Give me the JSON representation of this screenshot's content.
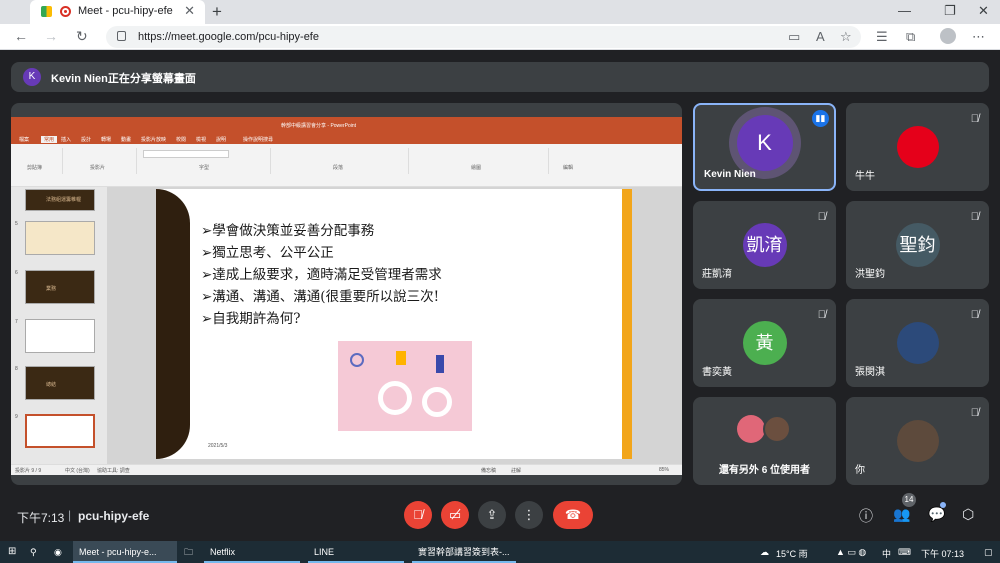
{
  "browser": {
    "tab_title": "Meet - pcu-hipy-efe",
    "tab_close": "✕",
    "new_tab": "+",
    "url": "https://meet.google.com/pcu-hipy-efe",
    "window_controls": [
      "—",
      "❐",
      "✕"
    ],
    "nav_icons": [
      "←",
      "→",
      "↻"
    ],
    "addr_icons": [
      "▭",
      "A",
      "☆",
      "☰",
      "⧉",
      "⋯"
    ]
  },
  "presenting": {
    "avatar_letter": "K",
    "text": "Kevin Nien正在分享螢幕畫面"
  },
  "powerpoint": {
    "title": "幹部中級講習會分享 - PowerPoint",
    "menu": [
      "檔案",
      "常用",
      "插入",
      "設計",
      "轉場",
      "動畫",
      "投影片放映",
      "校閱",
      "檢視",
      "說明",
      "操作說明搜尋"
    ],
    "ribbon_groups": [
      "剪貼簿",
      "投影片",
      "字型",
      "段落",
      "繪圖",
      "編輯"
    ],
    "thumb_numbers": [
      "5",
      "6",
      "7",
      "8",
      "9"
    ],
    "thumb_labels": [
      "法務組運籌帷幄",
      "",
      "業務",
      "",
      "總結",
      ""
    ],
    "slide_lines": [
      "➢學會做決策並妥善分配事務",
      "➢獨立思考、公平公正",
      "➢達成上級要求，適時滿足受管理者需求",
      "➢溝通、溝通、溝通(很重要所以說三次!",
      "➢自我期許為何?"
    ],
    "slide_date": "2021/5/3",
    "status_left": "投影片 9 / 9",
    "status_lang": "中文 (台灣)",
    "status_access": "協助工具: 調查",
    "status_notes": "備忘稿",
    "status_comments": "註解",
    "status_zoom": "85%"
  },
  "participants": [
    {
      "name": "Kevin Nien",
      "letter": "K",
      "color": "#673ab7"
    },
    {
      "name": "牛牛",
      "letter": "",
      "color": "#e5001a"
    },
    {
      "name": "莊凱淯",
      "letter": "凱淯",
      "color": "#673ab7"
    },
    {
      "name": "洪聖鈞",
      "letter": "聖鈞",
      "color": "#455a64"
    },
    {
      "name": "書奕黃",
      "letter": "黃",
      "color": "#4caf50"
    },
    {
      "name": "張閔淇",
      "letter": "",
      "color": "#2c4a7a"
    },
    {
      "name": "還有另外 6 位使用者",
      "letter": "",
      "color": ""
    },
    {
      "name": "你",
      "letter": "",
      "color": "#5d4a3c"
    }
  ],
  "bottom": {
    "time": "下午7:13",
    "separator": "|",
    "meeting_code": "pcu-hipy-efe",
    "people_count": "14",
    "icons": [
      "mic-off",
      "camera-off",
      "present",
      "more",
      "end-call",
      "info",
      "people",
      "chat",
      "activities"
    ]
  },
  "taskbar": {
    "items": [
      "Meet - pcu-hipy-e...",
      "",
      "Netflix",
      "LINE",
      "實習幹部講習簽到表-..."
    ],
    "weather": "15°C 雨",
    "ime": "中",
    "clock": "下午 07:13"
  }
}
